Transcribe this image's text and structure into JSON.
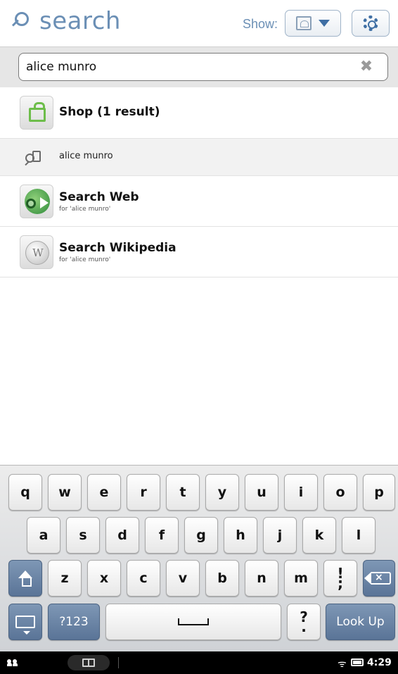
{
  "header": {
    "title": "search",
    "show_label": "Show:",
    "filter_icon": "library-book-icon",
    "dropdown_icon": "triangle-down-icon",
    "settings_icon": "gear-icon"
  },
  "search": {
    "value": "alice munro",
    "clear_icon": "✖"
  },
  "results": {
    "shop": {
      "title": "Shop (1 result)",
      "icon": "shopping-bag-icon"
    },
    "query": {
      "text": "alice munro",
      "icon": "library-search-icon"
    },
    "web": {
      "title": "Search Web",
      "subtitle": "for 'alice munro'",
      "icon": "web-search-icon"
    },
    "wiki": {
      "title": "Search Wikipedia",
      "subtitle": "for 'alice munro'",
      "icon": "wikipedia-globe-icon",
      "glyph": "W"
    }
  },
  "keyboard": {
    "row1": [
      "q",
      "w",
      "e",
      "r",
      "t",
      "y",
      "u",
      "i",
      "o",
      "p"
    ],
    "row2": [
      "a",
      "s",
      "d",
      "f",
      "g",
      "h",
      "j",
      "k",
      "l"
    ],
    "row3": [
      "z",
      "x",
      "c",
      "v",
      "b",
      "n",
      "m"
    ],
    "punct_top": "!",
    "punct_bottom": ";",
    "symbols": "?123",
    "question_top": "?",
    "question_bottom": ".",
    "action": "Look Up"
  },
  "statusbar": {
    "wifi_icon": "ᯤ",
    "time": "4:29"
  },
  "colors": {
    "accent": "#6b8fb5",
    "key_dark": "#6a84a6",
    "status_bg": "#000000"
  }
}
